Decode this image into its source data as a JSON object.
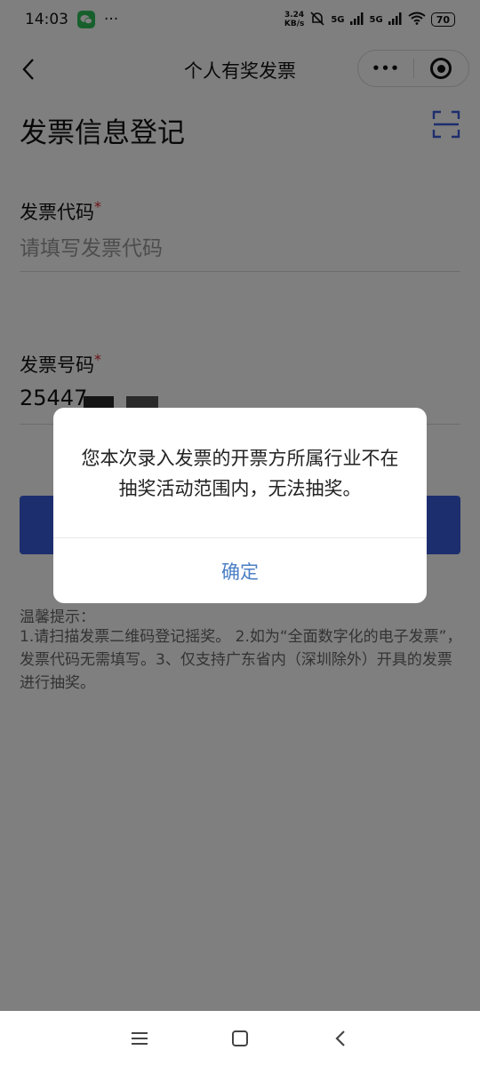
{
  "status_bar": {
    "time": "14:03",
    "dots": "···",
    "speed_value": "3.24",
    "speed_unit": "KB/s",
    "net1": "5G",
    "net2": "5G",
    "battery": "70"
  },
  "nav": {
    "title": "个人有奖发票",
    "more_label": "•••"
  },
  "page": {
    "heading": "发票信息登记",
    "invoice_code": {
      "label": "发票代码",
      "required_mark": "*",
      "placeholder": "请填写发票代码",
      "value": ""
    },
    "invoice_number": {
      "label": "发票号码",
      "required_mark": "*",
      "value": "25447"
    },
    "tips_title": "温馨提示：",
    "tips_body": "1.请扫描发票二维码登记摇奖。 2.如为“全面数字化的电子发票”，发票代码无需填写。3、仅支持广东省内（深圳除外）开具的发票进行抽奖。"
  },
  "dialog": {
    "message": "您本次录入发票的开票方所属行业不在抽奖活动范围内，无法抽奖。",
    "confirm_label": "确定"
  },
  "colors": {
    "accent": "#3a5cdc",
    "dialog_link": "#4a7fc4",
    "required": "#d9262e",
    "wechat_green": "#2ec15b"
  }
}
